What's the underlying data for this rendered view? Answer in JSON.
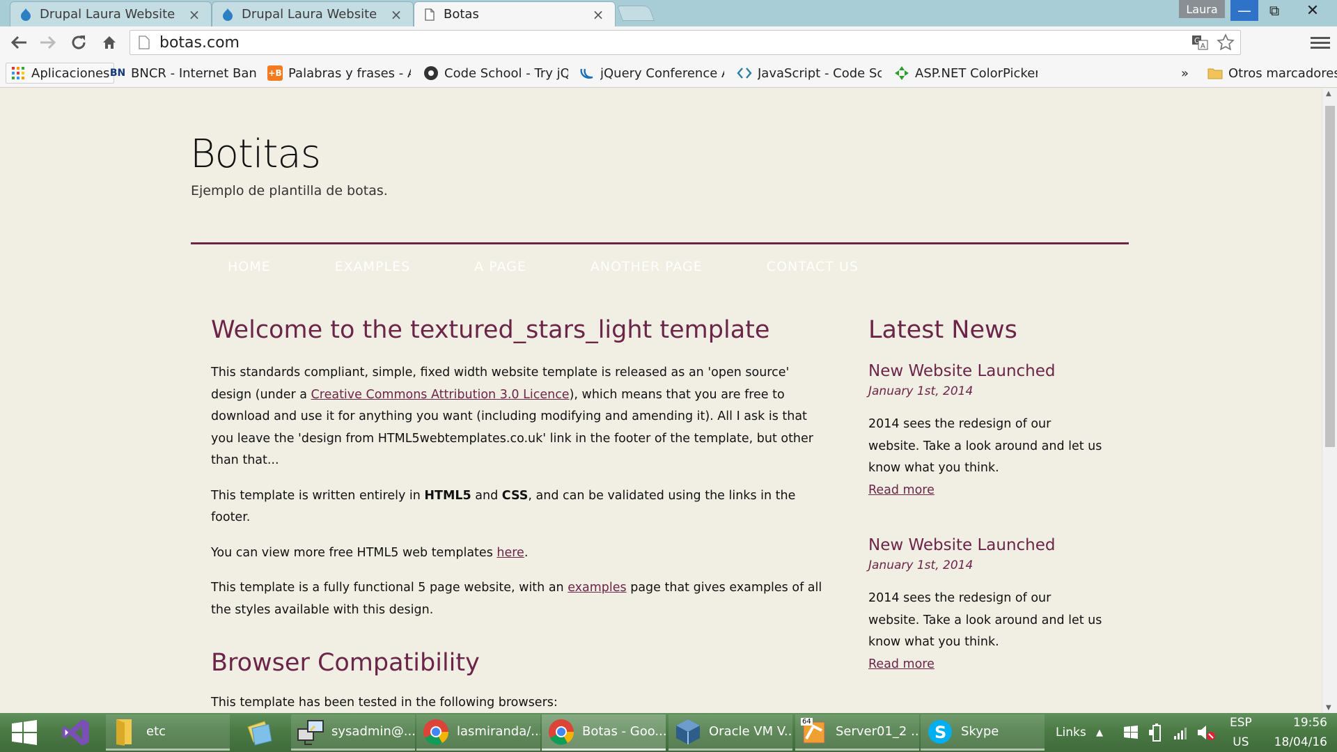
{
  "browser": {
    "tabs": [
      {
        "title": "Drupal Laura Website",
        "active": false
      },
      {
        "title": "Drupal Laura Website",
        "active": false
      },
      {
        "title": "Botas",
        "active": true
      }
    ],
    "profile_name": "Laura",
    "url": "botas.com",
    "bookmarks": [
      {
        "label": "Aplicaciones",
        "icon": "apps-grid-icon"
      },
      {
        "label": "BNCR - Internet Banki",
        "icon": "bncr-icon"
      },
      {
        "label": "Palabras y frases - Apr",
        "icon": "plus-b-icon"
      },
      {
        "label": "Code School - Try jQu",
        "icon": "code-school-icon"
      },
      {
        "label": "jQuery Conference Au",
        "icon": "jquery-icon"
      },
      {
        "label": "JavaScript - Code Sch",
        "icon": "code-brackets-icon"
      },
      {
        "label": "ASP.NET ColorPicker E",
        "icon": "colorpicker-icon"
      }
    ],
    "bookmarks_overflow": "»",
    "other_bookmarks": "Otros marcadores"
  },
  "site": {
    "title": "Botitas",
    "slogan": "Ejemplo de plantilla de botas.",
    "nav": [
      "HOME",
      "EXAMPLES",
      "A PAGE",
      "ANOTHER PAGE",
      "CONTACT US"
    ]
  },
  "main": {
    "heading": "Welcome to the textured_stars_light template",
    "p1_a": "This standards compliant, simple, fixed width website template is released as an 'open source' design (under a ",
    "p1_link": "Creative Commons Attribution 3.0 Licence",
    "p1_b": "), which means that you are free to download and use it for anything you want (including modifying and amending it). All I ask is that you leave the 'design from HTML5webtemplates.co.uk' link in the footer of the template, but other than that...",
    "p2_a": "This template is written entirely in ",
    "p2_b1": "HTML5",
    "p2_mid": " and ",
    "p2_b2": "CSS",
    "p2_c": ", and can be validated using the links in the footer.",
    "p3_a": "You can view more free HTML5 web templates ",
    "p3_link": "here",
    "p3_b": ".",
    "p4_a": "This template is a fully functional 5 page website, with an ",
    "p4_link": "examples",
    "p4_b": " page that gives examples of all the styles available with this design.",
    "heading2": "Browser Compatibility",
    "p5": "This template has been tested in the following browsers:"
  },
  "sidebar": {
    "heading": "Latest News",
    "news": [
      {
        "title": "New Website Launched",
        "date": "January 1st, 2014",
        "text": "2014 sees the redesign of our website. Take a look around and let us know what you think.",
        "link": "Read more"
      },
      {
        "title": "New Website Launched",
        "date": "January 1st, 2014",
        "text": "2014 sees the redesign of our website. Take a look around and let us know what you think.",
        "link": "Read more"
      }
    ]
  },
  "taskbar": {
    "items": [
      {
        "label": "",
        "icon": "windows-start-icon"
      },
      {
        "label": "",
        "icon": "visual-studio-icon"
      },
      {
        "label": "etc",
        "icon": "folder-icon"
      },
      {
        "label": "",
        "icon": "sticky-notes-icon"
      },
      {
        "label": "sysadmin@...",
        "icon": "putty-icon"
      },
      {
        "label": "lasmiranda/...",
        "icon": "chrome-icon"
      },
      {
        "label": "Botas - Goo...",
        "icon": "chrome-icon"
      },
      {
        "label": "Oracle VM V...",
        "icon": "virtualbox-icon"
      },
      {
        "label": "Server01_2 ...",
        "icon": "vmware-icon"
      },
      {
        "label": "Skype",
        "icon": "skype-icon"
      }
    ],
    "links_label": "Links",
    "language_top": "ESP",
    "language_bottom": "US",
    "time": "19:56",
    "date": "18/04/16",
    "vmware_badge": "64"
  },
  "colors": {
    "accent": "#6b2549",
    "page_bg": "#f1efe3",
    "tabstrip": "#a9cdd6"
  }
}
